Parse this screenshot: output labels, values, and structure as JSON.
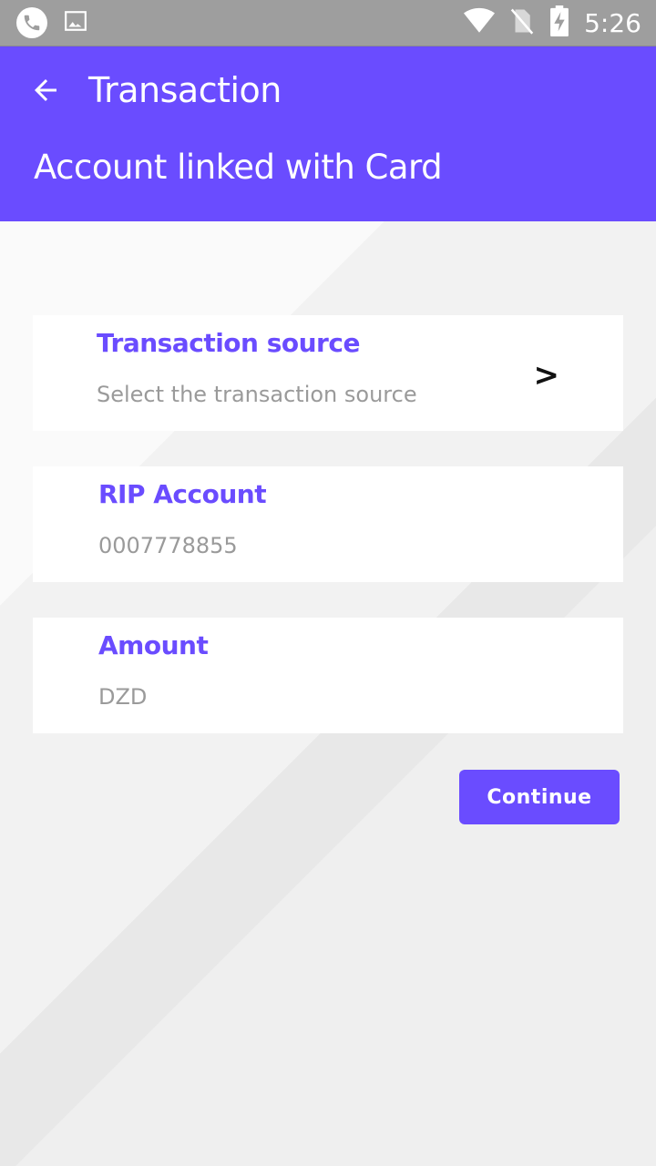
{
  "status_bar": {
    "time": "5:26",
    "icons": [
      "phone-icon",
      "image-icon",
      "wifi-icon",
      "no-sim-icon",
      "battery-charging-icon"
    ]
  },
  "app_bar": {
    "title": "Transaction",
    "subtitle": "Account linked with Card",
    "back_icon": "arrow-left-icon",
    "color": "#6a4cff"
  },
  "fields": {
    "source": {
      "label": "Transaction source",
      "placeholder": "Select the transaction source",
      "chevron": ">"
    },
    "rip": {
      "label": "RIP Account",
      "value": "0007778855"
    },
    "amount": {
      "label": "Amount",
      "value": "DZD"
    }
  },
  "continue_label": "Continue"
}
